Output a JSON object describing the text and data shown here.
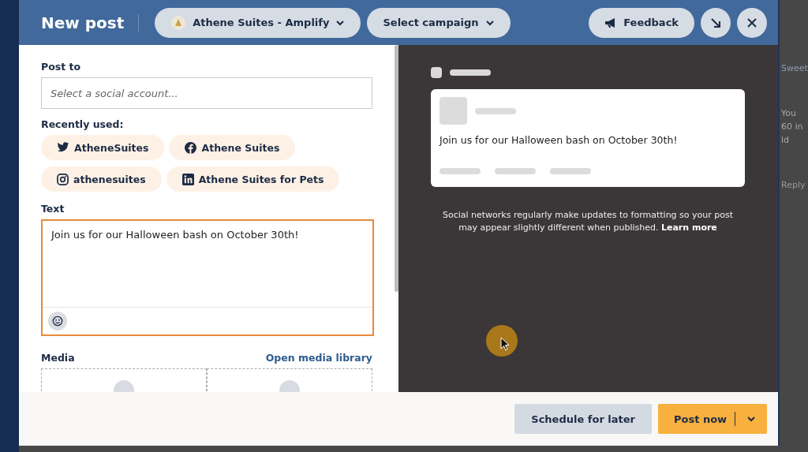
{
  "header": {
    "title": "New post",
    "account": "Athene Suites - Amplify",
    "campaign": "Select campaign",
    "feedback": "Feedback"
  },
  "post_to": {
    "label": "Post to",
    "placeholder": "Select a social account..."
  },
  "recently_used": {
    "label": "Recently used:",
    "accounts": [
      {
        "kind": "twitter",
        "name": "AtheneSuites"
      },
      {
        "kind": "facebook",
        "name": "Athene Suites"
      },
      {
        "kind": "instagram",
        "name": "athenesuites"
      },
      {
        "kind": "linkedin",
        "name": "Athene Suites for Pets"
      }
    ]
  },
  "text": {
    "label": "Text",
    "value": "Join us for our Halloween bash on October 30th!"
  },
  "media": {
    "label": "Media",
    "link": "Open media library"
  },
  "preview": {
    "text": "Join us for our Halloween bash on October 30th!",
    "note": "Social networks regularly make updates to formatting so your post may appear slightly different when published.",
    "link": "Learn more"
  },
  "footer": {
    "schedule": "Schedule for later",
    "post": "Post now"
  },
  "background": {
    "texts": [
      "Sweet",
      "You",
      "60 in",
      "ld",
      "Reply"
    ]
  }
}
